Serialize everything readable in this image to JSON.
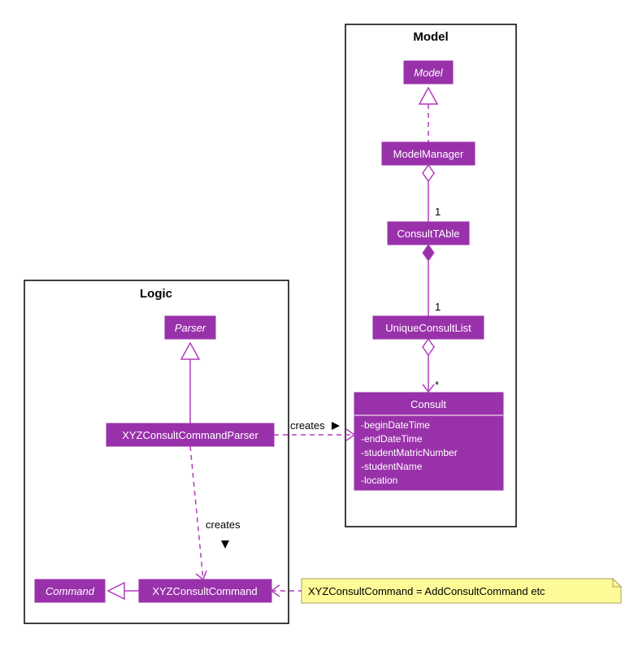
{
  "packages": {
    "logic": {
      "title": "Logic"
    },
    "model": {
      "title": "Model"
    }
  },
  "classes": {
    "parser": {
      "name": "Parser"
    },
    "xyzParser": {
      "name": "XYZConsultCommandParser"
    },
    "command": {
      "name": "Command"
    },
    "xyzCommand": {
      "name": "XYZConsultCommand"
    },
    "modelInterface": {
      "name": "Model"
    },
    "modelManager": {
      "name": "ModelManager"
    },
    "consultTable": {
      "name": "ConsultTAble"
    },
    "uniqueConsultList": {
      "name": "UniqueConsultList"
    },
    "consult": {
      "name": "Consult",
      "attributes": [
        "-beginDateTime",
        "-endDateTime",
        "-studentMatricNumber",
        "-studentName",
        "-location"
      ]
    }
  },
  "multiplicities": {
    "m1": "1",
    "m2": "1",
    "m3": "*"
  },
  "labels": {
    "creates1": "creates",
    "creates2": "creates"
  },
  "note": {
    "text": "XYZConsultCommand = AddConsultCommand etc"
  }
}
